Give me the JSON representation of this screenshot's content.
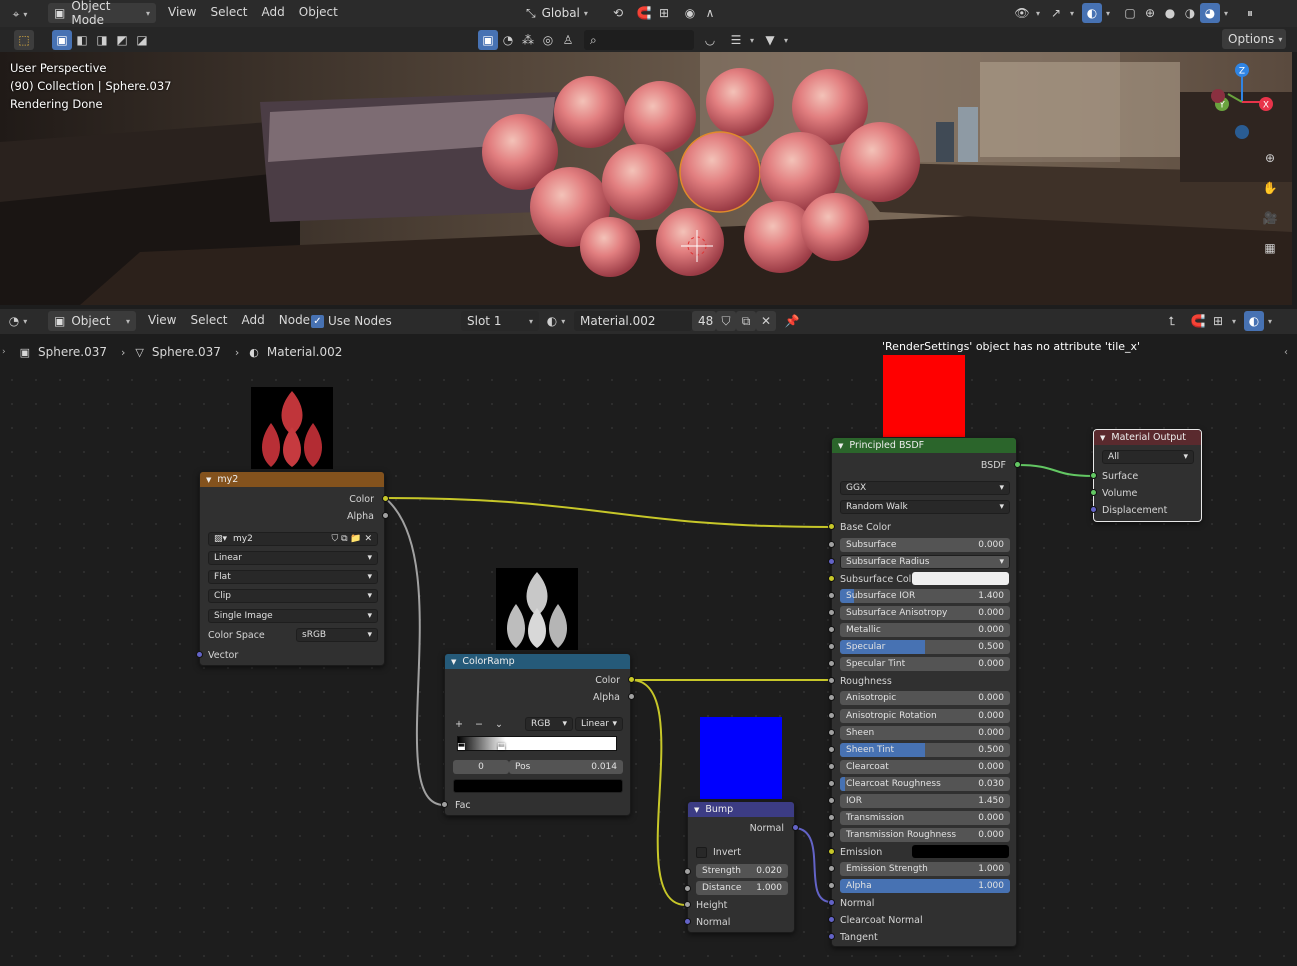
{
  "header": {
    "mode": "Object Mode",
    "menus": [
      "View",
      "Select",
      "Add",
      "Object"
    ],
    "orientation": "Global",
    "options_label": "Options"
  },
  "viewport": {
    "perspective": "User Perspective",
    "collection": "(90) Collection | Sphere.037",
    "status": "Rendering Done",
    "gizmo_axes": [
      "Z",
      "X",
      "Y"
    ]
  },
  "node_header": {
    "type": "Object",
    "menus": [
      "View",
      "Select",
      "Add",
      "Node"
    ],
    "use_nodes_label": "Use Nodes",
    "use_nodes_checked": true,
    "slot": "Slot 1",
    "material": "Material.002",
    "users": "48"
  },
  "breadcrumb": [
    "Sphere.037",
    "Sphere.037",
    "Material.002"
  ],
  "error_message": "'RenderSettings' object has no attribute 'tile_x'",
  "nodes": {
    "image": {
      "title": "my2",
      "out_color": "Color",
      "out_alpha": "Alpha",
      "image_name": "my2",
      "interpolation": "Linear",
      "projection": "Flat",
      "extension": "Clip",
      "source": "Single Image",
      "color_space_label": "Color Space",
      "color_space": "sRGB",
      "in_vector": "Vector"
    },
    "colorramp": {
      "title": "ColorRamp",
      "out_color": "Color",
      "out_alpha": "Alpha",
      "add": "+",
      "remove": "−",
      "mode": "RGB",
      "interp": "Linear",
      "index": "0",
      "pos_label": "Pos",
      "pos_value": "0.014",
      "in_fac": "Fac"
    },
    "bump": {
      "title": "Bump",
      "out_normal": "Normal",
      "invert": "Invert",
      "strength_label": "Strength",
      "strength": "0.020",
      "distance_label": "Distance",
      "distance": "1.000",
      "in_height": "Height",
      "in_normal": "Normal"
    },
    "bsdf": {
      "title": "Principled BSDF",
      "out": "BSDF",
      "distribution": "GGX",
      "subsurface_method": "Random Walk",
      "base_color": "Base Color",
      "fields": [
        {
          "label": "Subsurface",
          "value": "0.000",
          "fill": 0
        },
        {
          "label": "Subsurface Radius",
          "value": "",
          "fill": 0,
          "dropdown": true
        },
        {
          "label": "Subsurface Col",
          "value": "",
          "fill": 0,
          "color": "#f0f0f0"
        },
        {
          "label": "Subsurface IOR",
          "value": "1.400",
          "fill": 0.08
        },
        {
          "label": "Subsurface Anisotropy",
          "value": "0.000",
          "fill": 0
        },
        {
          "label": "Metallic",
          "value": "0.000",
          "fill": 0
        },
        {
          "label": "Specular",
          "value": "0.500",
          "fill": 0.5
        },
        {
          "label": "Specular Tint",
          "value": "0.000",
          "fill": 0
        },
        {
          "label": "Roughness",
          "value": "",
          "fill": 0,
          "socket_only": true
        },
        {
          "label": "Anisotropic",
          "value": "0.000",
          "fill": 0
        },
        {
          "label": "Anisotropic Rotation",
          "value": "0.000",
          "fill": 0
        },
        {
          "label": "Sheen",
          "value": "0.000",
          "fill": 0
        },
        {
          "label": "Sheen Tint",
          "value": "0.500",
          "fill": 0.5
        },
        {
          "label": "Clearcoat",
          "value": "0.000",
          "fill": 0
        },
        {
          "label": "Clearcoat Roughness",
          "value": "0.030",
          "fill": 0.03
        },
        {
          "label": "IOR",
          "value": "1.450",
          "fill": 0
        },
        {
          "label": "Transmission",
          "value": "0.000",
          "fill": 0
        },
        {
          "label": "Transmission Roughness",
          "value": "0.000",
          "fill": 0
        },
        {
          "label": "Emission",
          "value": "",
          "fill": 0,
          "color": "#000000"
        },
        {
          "label": "Emission Strength",
          "value": "1.000",
          "fill": 0
        },
        {
          "label": "Alpha",
          "value": "1.000",
          "fill": 1
        },
        {
          "label": "Normal",
          "value": "",
          "fill": 0,
          "socket_only": true
        },
        {
          "label": "Clearcoat Normal",
          "value": "",
          "fill": 0,
          "socket_only": true
        },
        {
          "label": "Tangent",
          "value": "",
          "fill": 0,
          "socket_only": true
        }
      ]
    },
    "output": {
      "title": "Material Output",
      "target": "All",
      "inputs": [
        "Surface",
        "Volume",
        "Displacement"
      ]
    }
  },
  "colors": {
    "accent": "#4772b3",
    "image_header": "#83521d",
    "ramp_header": "#255a79",
    "bump_header": "#3c3c84",
    "bsdf_header": "#2b652b",
    "output_header": "#5a2a2e",
    "preview_red": "#ff0000",
    "preview_blue": "#0000ff"
  }
}
